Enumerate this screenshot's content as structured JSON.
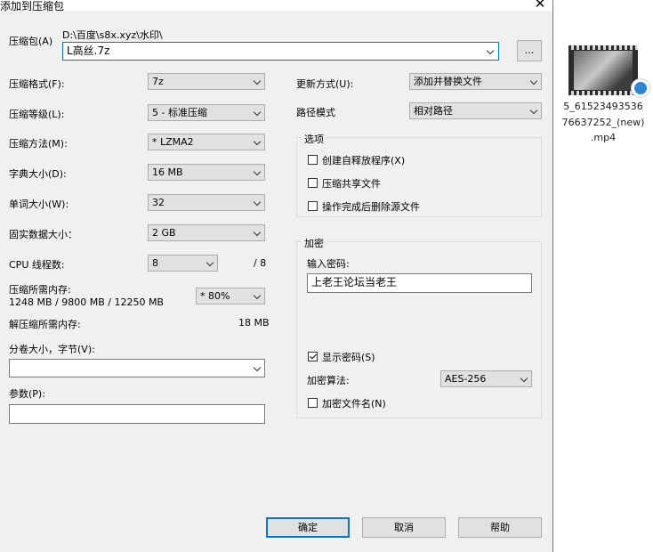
{
  "dialog": {
    "title": "添加到压缩包",
    "close_glyph": "✕",
    "archive_label": "压缩包(A)",
    "archive_path": "D:\\百度\\s8x.xyz\\水印\\",
    "archive_name": "L高丝.7z",
    "browse_label": "...",
    "left": {
      "format_label": "压缩格式(F):",
      "format_value": "7z",
      "level_label": "压缩等级(L):",
      "level_value": "5 - 标准压缩",
      "method_label": "压缩方法(M):",
      "method_value": "*  LZMA2",
      "dict_label": "字典大小(D):",
      "dict_value": "16 MB",
      "word_label": "单词大小(W):",
      "word_value": "32",
      "solid_label": "固实数据大小：",
      "solid_value": "2 GB",
      "cpu_label": "CPU 线程数:",
      "cpu_value": "8",
      "cpu_max": "/ 8",
      "mem_comp_label": "压缩所需内存:",
      "mem_comp_value": "1248 MB / 9800 MB / 12250 MB",
      "mem_percent": "* 80%",
      "mem_decomp_label": "解压缩所需内存:",
      "mem_decomp_value": "18 MB",
      "split_label": "分卷大小，字节(V):",
      "split_value": "",
      "params_label": "参数(P):",
      "params_value": ""
    },
    "right": {
      "update_label": "更新方式(U):",
      "update_value": "添加并替换文件",
      "path_label": "路径模式",
      "path_value": "相对路径",
      "options_title": "选项",
      "opt_sfx": "创建自释放程序(X)",
      "opt_shared": "压缩共享文件",
      "opt_delete": "操作完成后删除源文件",
      "encrypt_title": "加密",
      "password_label": "输入密码:",
      "password_value": "上老王论坛当老王",
      "show_password": "显示密码(S)",
      "algo_label": "加密算法:",
      "algo_value": "AES-256",
      "encrypt_names": "加密文件名(N)"
    },
    "buttons": {
      "ok": "确定",
      "cancel": "取消",
      "help": "帮助"
    }
  },
  "desktop_file": {
    "name_line1": "5_61523493536",
    "name_line2": "76637252_(new)",
    "name_line3": ".mp4"
  }
}
